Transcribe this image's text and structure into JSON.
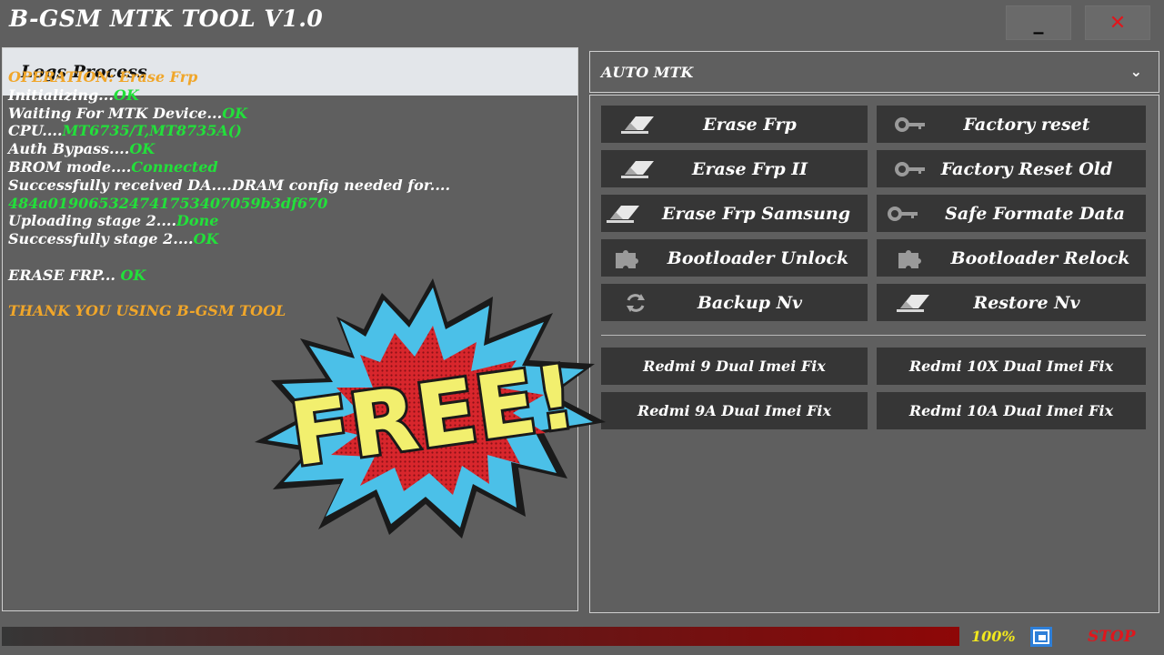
{
  "app": {
    "title": "B-GSM MTK TOOL V1.0",
    "minimize_label": "_",
    "close_label": "✕"
  },
  "logs": {
    "header": "Logs Process",
    "lines": [
      [
        {
          "t": "OPERATION: Erase Frp",
          "c": "orange"
        }
      ],
      [
        {
          "t": "Initializing...",
          "c": "white"
        },
        {
          "t": "OK",
          "c": "green"
        }
      ],
      [
        {
          "t": "Waiting For MTK Device...",
          "c": "white"
        },
        {
          "t": "OK",
          "c": "green"
        }
      ],
      [
        {
          "t": "CPU....",
          "c": "white"
        },
        {
          "t": "MT6735/T,MT8735A()",
          "c": "green"
        }
      ],
      [
        {
          "t": "Auth Bypass....",
          "c": "white"
        },
        {
          "t": "OK",
          "c": "green"
        }
      ],
      [
        {
          "t": "BROM mode....",
          "c": "white"
        },
        {
          "t": "Connected",
          "c": "green"
        }
      ],
      [
        {
          "t": "Successfully received DA....DRAM config needed for....",
          "c": "white"
        }
      ],
      [
        {
          "t": "484a0190653247417534 07059b3df670",
          "c": "green"
        }
      ],
      [
        {
          "t": "Uploading stage 2....",
          "c": "white"
        },
        {
          "t": "Done",
          "c": "green"
        }
      ],
      [
        {
          "t": "Successfully stage 2....",
          "c": "white"
        },
        {
          "t": "OK",
          "c": "green"
        }
      ],
      [],
      [
        {
          "t": "ERASE FRP... ",
          "c": "white"
        },
        {
          "t": "OK",
          "c": "green"
        }
      ],
      [],
      [
        {
          "t": "THANK YOU USING B-GSM TOOL",
          "c": "orange"
        }
      ]
    ]
  },
  "mode": {
    "selected": "AUTO MTK"
  },
  "buttons": {
    "erase_frp": "Erase Frp",
    "factory_reset": "Factory reset",
    "erase_frp_ii": "Erase Frp II",
    "factory_reset_old": "Factory Reset Old",
    "erase_frp_samsung": "Erase Frp Samsung",
    "safe_formate_data": "Safe Formate Data",
    "bootloader_unlock": "Bootloader Unlock",
    "bootloader_relock": "Bootloader Relock",
    "backup_nv": "Backup Nv",
    "restore_nv": "Restore Nv",
    "redmi9": "Redmi 9 Dual Imei Fix",
    "redmi10x": "Redmi 10X Dual Imei Fix",
    "redmi9a": "Redmi 9A Dual Imei Fix",
    "redmi10a": "Redmi 10A Dual Imei Fix"
  },
  "icons": {
    "eraser": "eraser-icon",
    "key": "key-icon",
    "puzzle": "puzzle-icon",
    "sync": "sync-icon"
  },
  "status": {
    "progress": 1.0,
    "progress_label": "100%",
    "stop_label": "STOP"
  },
  "overlay": {
    "text": "FREE!"
  },
  "colors": {
    "ok_green": "#22e03a",
    "orange": "#f0a62a",
    "stop_red": "#e0161c",
    "percent_yellow": "#f2e81e"
  }
}
